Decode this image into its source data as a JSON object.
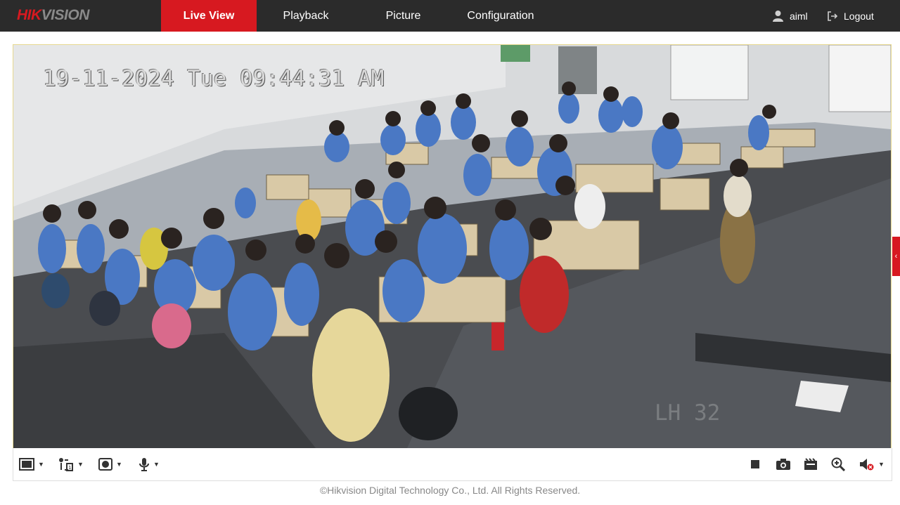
{
  "brand": {
    "logo_hik": "HIK",
    "logo_vision": "VISION"
  },
  "nav": {
    "tabs": [
      {
        "label": "Live View",
        "active": true
      },
      {
        "label": "Playback",
        "active": false
      },
      {
        "label": "Picture",
        "active": false
      },
      {
        "label": "Configuration",
        "active": false
      }
    ]
  },
  "user": {
    "name": "aiml",
    "icon": "user-icon"
  },
  "logout": {
    "label": "Logout",
    "icon": "logout-icon"
  },
  "video": {
    "osd_datetime": "19-11-2024 Tue 09:44:31 AM",
    "osd_channel_name": "LH 32",
    "side_panel_toggle": "‹"
  },
  "toolbar": {
    "left": [
      {
        "name": "window-layout",
        "icon": "window-layout-icon"
      },
      {
        "name": "stream-type",
        "icon": "stream-type-icon"
      },
      {
        "name": "plugin",
        "icon": "plugin-icon"
      },
      {
        "name": "two-way-audio",
        "icon": "microphone-icon"
      }
    ],
    "right": [
      {
        "name": "stop-live-view",
        "icon": "stop-icon"
      },
      {
        "name": "capture",
        "icon": "camera-icon"
      },
      {
        "name": "record",
        "icon": "record-icon"
      },
      {
        "name": "digital-zoom",
        "icon": "zoom-in-icon"
      },
      {
        "name": "audio",
        "icon": "speaker-muted-icon"
      }
    ]
  },
  "footer": {
    "copyright": "©Hikvision Digital Technology Co., Ltd. All Rights Reserved."
  },
  "colors": {
    "accent": "#d71920",
    "topbar": "#2b2b2b"
  }
}
